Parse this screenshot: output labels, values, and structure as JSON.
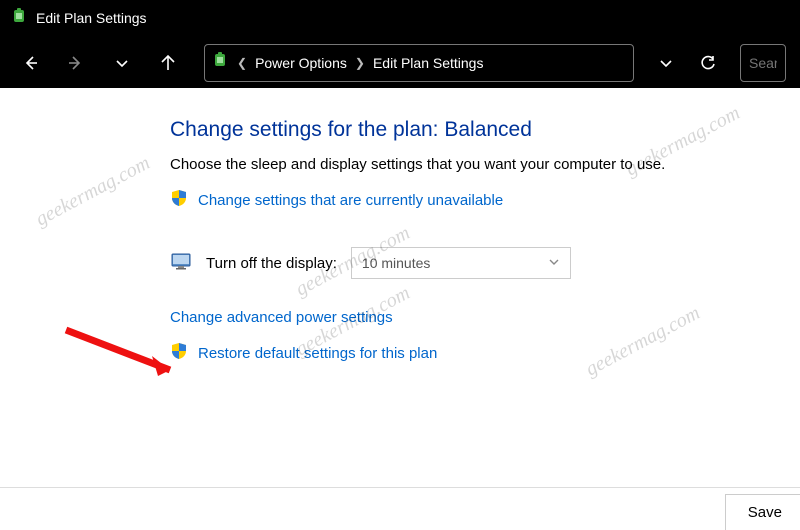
{
  "window": {
    "title": "Edit Plan Settings"
  },
  "breadcrumb": {
    "seg1": "Power Options",
    "seg2": "Edit Plan Settings"
  },
  "search": {
    "placeholder": "Search"
  },
  "page": {
    "heading_prefix": "Change settings for the plan: ",
    "plan_name": "Balanced",
    "subheading": "Choose the sleep and display settings that you want your computer to use.",
    "link_unavailable": "Change settings that are currently unavailable",
    "setting_label": "Turn off the display:",
    "setting_value": "10 minutes",
    "link_advanced": "Change advanced power settings",
    "link_restore": "Restore default settings for this plan"
  },
  "footer": {
    "save": "Save"
  },
  "watermark": "geekermag.com"
}
